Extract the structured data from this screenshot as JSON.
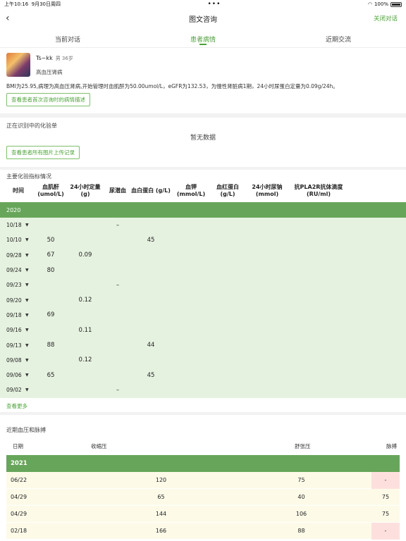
{
  "status": {
    "time": "上午10:16",
    "date": "9月30日周四",
    "battery": "100%"
  },
  "nav": {
    "title": "图文咨询",
    "close": "关闭对话"
  },
  "tabs": [
    {
      "label": "当前对话",
      "active": false
    },
    {
      "label": "患者病情",
      "active": true
    },
    {
      "label": "近期交流",
      "active": false
    }
  ],
  "patient": {
    "name": "Ts~kk",
    "meta": "男 36岁",
    "diagnosis": "高血压肾病",
    "description": "BMI为25.95,病理为高血压肾病,开始管理时血肌酐为50.00umol/L，eGFR为132.53，为慢性肾脏病1期，24小时尿蛋白定量为0.09g/24h。",
    "first_visit_button": "查看患者首次咨询时的病情描述"
  },
  "lab_recognizing": {
    "title": "正在识别中的化验单",
    "empty": "暂无数据",
    "upload_button": "查看患者所有图片上传记录"
  },
  "lab_main": {
    "title": "主要化验指标情况",
    "headers": [
      "时间",
      "血肌酐 (umol/L)",
      "24小时定量 (g)",
      "尿潜血",
      "血白蛋白 (g/L)",
      "血钾 (mmol/L)",
      "血红蛋白 (g/L)",
      "24小时尿钠 (mmol)",
      "抗PLA2R抗体滴度 (RU/ml)"
    ],
    "year": "2020",
    "rows": [
      {
        "date": "10/18",
        "cr": "",
        "q24": "",
        "ob": "–",
        "alb": ""
      },
      {
        "date": "10/10",
        "cr": "50",
        "q24": "",
        "ob": "",
        "alb": "45"
      },
      {
        "date": "09/28",
        "cr": "67",
        "q24": "0.09",
        "ob": "",
        "alb": ""
      },
      {
        "date": "09/24",
        "cr": "80",
        "q24": "",
        "ob": "",
        "alb": ""
      },
      {
        "date": "09/23",
        "cr": "",
        "q24": "",
        "ob": "–",
        "alb": ""
      },
      {
        "date": "09/20",
        "cr": "",
        "q24": "0.12",
        "ob": "",
        "alb": ""
      },
      {
        "date": "09/18",
        "cr": "69",
        "q24": "",
        "ob": "",
        "alb": ""
      },
      {
        "date": "09/16",
        "cr": "",
        "q24": "0.11",
        "ob": "",
        "alb": ""
      },
      {
        "date": "09/13",
        "cr": "88",
        "q24": "",
        "ob": "",
        "alb": "44"
      },
      {
        "date": "09/08",
        "cr": "",
        "q24": "0.12",
        "ob": "",
        "alb": ""
      },
      {
        "date": "09/06",
        "cr": "65",
        "q24": "",
        "ob": "",
        "alb": "45"
      },
      {
        "date": "09/02",
        "cr": "",
        "q24": "",
        "ob": "–",
        "alb": ""
      }
    ],
    "more": "查看更多"
  },
  "bp": {
    "title": "近期血压和脉搏",
    "headers": [
      "日期",
      "收缩压",
      "舒张压",
      "脉搏"
    ],
    "year": "2021",
    "rows": [
      {
        "date": "06/22",
        "sys": "120",
        "dia": "75",
        "pulse": "-",
        "abnormal": true
      },
      {
        "date": "04/29",
        "sys": "65",
        "dia": "40",
        "pulse": "75",
        "abnormal": false
      },
      {
        "date": "04/29",
        "sys": "144",
        "dia": "106",
        "pulse": "75",
        "abnormal": false
      },
      {
        "date": "02/18",
        "sys": "166",
        "dia": "88",
        "pulse": "-",
        "abnormal": true
      }
    ]
  }
}
